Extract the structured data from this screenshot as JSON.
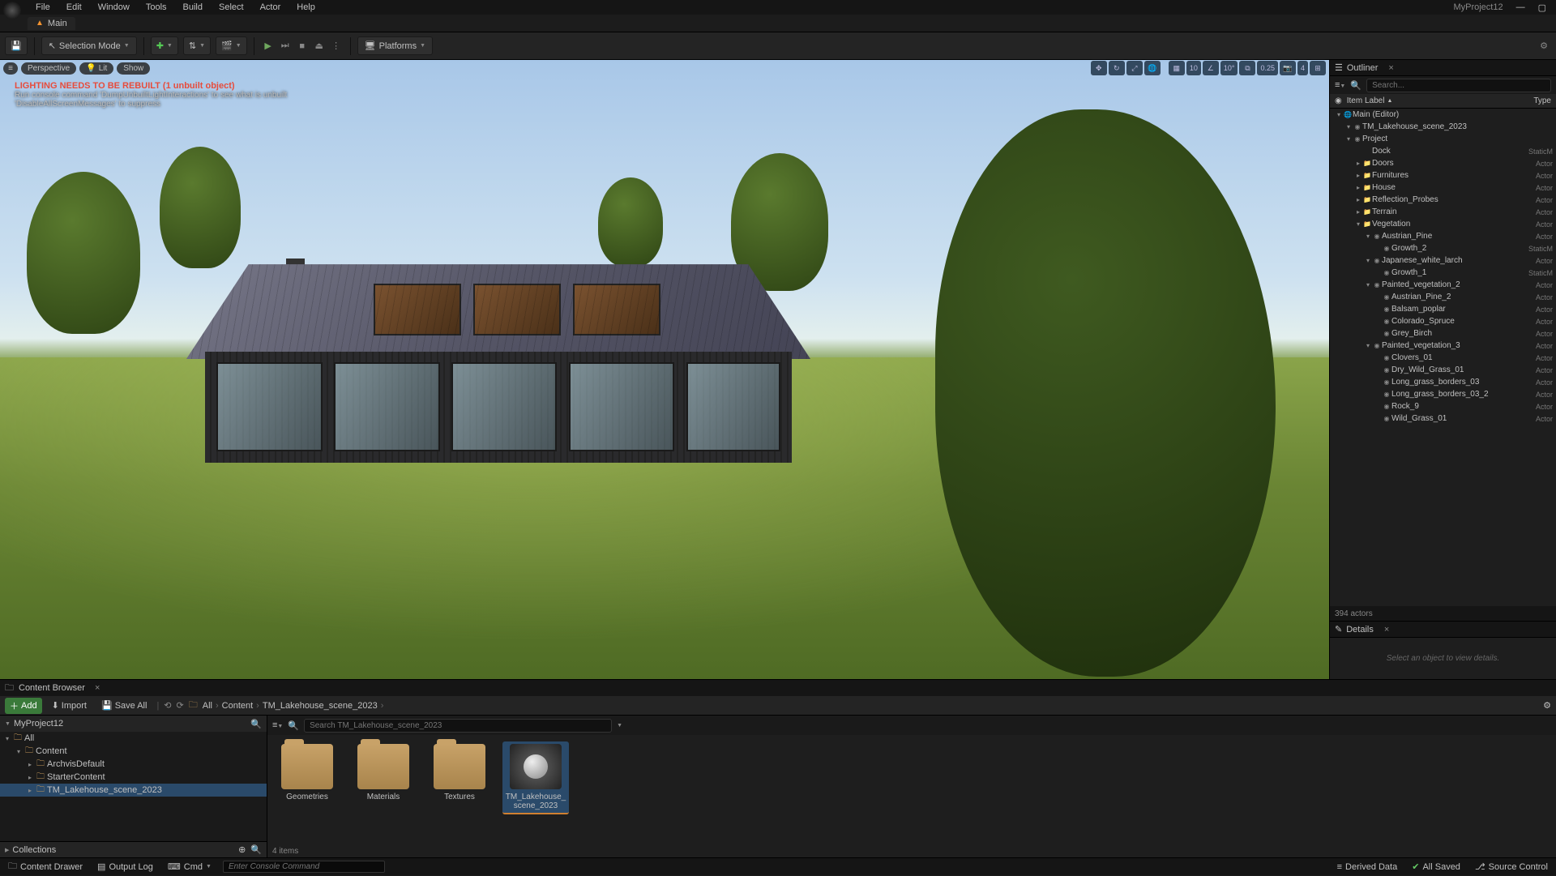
{
  "menu": {
    "items": [
      "File",
      "Edit",
      "Window",
      "Tools",
      "Build",
      "Select",
      "Actor",
      "Help"
    ],
    "project": "MyProject12"
  },
  "level_tab": {
    "name": "Main"
  },
  "toolbar": {
    "save_tip": "Save",
    "selection_mode": "Selection Mode",
    "platforms": "Platforms"
  },
  "viewport": {
    "perspective": "Perspective",
    "lit": "Lit",
    "show": "Show",
    "snap_angle": "10°",
    "snap_scale": "0.25",
    "cam_speed": "4",
    "warning_title": "LIGHTING NEEDS TO BE REBUILT (1 unbuilt object)",
    "warning_line2": "Run console command 'DumpUnbuiltLightInteractions' to see what is unbuilt",
    "warning_line3": "'DisableAllScreenMessages' to suppress"
  },
  "outliner": {
    "title": "Outliner",
    "search_placeholder": "Search...",
    "col_label": "Item Label",
    "col_type": "Type",
    "footer": "394 actors",
    "tree": [
      {
        "indent": 0,
        "caret": "▾",
        "ico": "🌐",
        "label": "Main (Editor)",
        "type": ""
      },
      {
        "indent": 1,
        "caret": "▾",
        "ico": "◉",
        "label": "TM_Lakehouse_scene_2023",
        "type": ""
      },
      {
        "indent": 1,
        "caret": "▾",
        "ico": "◉",
        "label": "Project",
        "type": ""
      },
      {
        "indent": 2,
        "caret": "",
        "ico": "",
        "label": "Dock",
        "type": "StaticM"
      },
      {
        "indent": 2,
        "caret": "▸",
        "ico": "📁",
        "label": "Doors",
        "type": "Actor"
      },
      {
        "indent": 2,
        "caret": "▸",
        "ico": "📁",
        "label": "Furnitures",
        "type": "Actor"
      },
      {
        "indent": 2,
        "caret": "▸",
        "ico": "📁",
        "label": "House",
        "type": "Actor"
      },
      {
        "indent": 2,
        "caret": "▸",
        "ico": "📁",
        "label": "Reflection_Probes",
        "type": "Actor"
      },
      {
        "indent": 2,
        "caret": "▸",
        "ico": "📁",
        "label": "Terrain",
        "type": "Actor"
      },
      {
        "indent": 2,
        "caret": "▾",
        "ico": "📁",
        "label": "Vegetation",
        "type": "Actor"
      },
      {
        "indent": 3,
        "caret": "▾",
        "ico": "◉",
        "label": "Austrian_Pine",
        "type": "Actor"
      },
      {
        "indent": 4,
        "caret": "",
        "ico": "◉",
        "label": "Growth_2",
        "type": "StaticM"
      },
      {
        "indent": 3,
        "caret": "▾",
        "ico": "◉",
        "label": "Japanese_white_larch",
        "type": "Actor"
      },
      {
        "indent": 4,
        "caret": "",
        "ico": "◉",
        "label": "Growth_1",
        "type": "StaticM"
      },
      {
        "indent": 3,
        "caret": "▾",
        "ico": "◉",
        "label": "Painted_vegetation_2",
        "type": "Actor"
      },
      {
        "indent": 4,
        "caret": "",
        "ico": "◉",
        "label": "Austrian_Pine_2",
        "type": "Actor"
      },
      {
        "indent": 4,
        "caret": "",
        "ico": "◉",
        "label": "Balsam_poplar",
        "type": "Actor"
      },
      {
        "indent": 4,
        "caret": "",
        "ico": "◉",
        "label": "Colorado_Spruce",
        "type": "Actor"
      },
      {
        "indent": 4,
        "caret": "",
        "ico": "◉",
        "label": "Grey_Birch",
        "type": "Actor"
      },
      {
        "indent": 3,
        "caret": "▾",
        "ico": "◉",
        "label": "Painted_vegetation_3",
        "type": "Actor"
      },
      {
        "indent": 4,
        "caret": "",
        "ico": "◉",
        "label": "Clovers_01",
        "type": "Actor"
      },
      {
        "indent": 4,
        "caret": "",
        "ico": "◉",
        "label": "Dry_Wild_Grass_01",
        "type": "Actor"
      },
      {
        "indent": 4,
        "caret": "",
        "ico": "◉",
        "label": "Long_grass_borders_03",
        "type": "Actor"
      },
      {
        "indent": 4,
        "caret": "",
        "ico": "◉",
        "label": "Long_grass_borders_03_2",
        "type": "Actor"
      },
      {
        "indent": 4,
        "caret": "",
        "ico": "◉",
        "label": "Rock_9",
        "type": "Actor"
      },
      {
        "indent": 4,
        "caret": "",
        "ico": "◉",
        "label": "Wild_Grass_01",
        "type": "Actor"
      }
    ]
  },
  "details": {
    "title": "Details",
    "empty": "Select an object to view details."
  },
  "content_browser": {
    "title": "Content Browser",
    "add": "Add",
    "import": "Import",
    "save_all": "Save All",
    "breadcrumbs": [
      "All",
      "Content",
      "TM_Lakehouse_scene_2023"
    ],
    "sources_header": "MyProject12",
    "tree": [
      {
        "indent": 0,
        "caret": "▾",
        "label": "All",
        "sel": false
      },
      {
        "indent": 1,
        "caret": "▾",
        "label": "Content",
        "sel": false
      },
      {
        "indent": 2,
        "caret": "▸",
        "label": "ArchvisDefault",
        "sel": false
      },
      {
        "indent": 2,
        "caret": "▸",
        "label": "StarterContent",
        "sel": false
      },
      {
        "indent": 2,
        "caret": "▸",
        "label": "TM_Lakehouse_scene_2023",
        "sel": true
      }
    ],
    "collections": "Collections",
    "search_placeholder": "Search TM_Lakehouse_scene_2023",
    "assets": [
      {
        "type": "folder",
        "label": "Geometries",
        "sel": false
      },
      {
        "type": "folder",
        "label": "Materials",
        "sel": false
      },
      {
        "type": "folder",
        "label": "Textures",
        "sel": false
      },
      {
        "type": "level",
        "label": "TM_Lakehouse_scene_2023",
        "sel": true
      }
    ],
    "footer": "4 items"
  },
  "status": {
    "content_drawer": "Content Drawer",
    "output_log": "Output Log",
    "cmd": "Cmd",
    "cmd_placeholder": "Enter Console Command",
    "derived_data": "Derived Data",
    "all_saved": "All Saved",
    "source_control": "Source Control"
  }
}
